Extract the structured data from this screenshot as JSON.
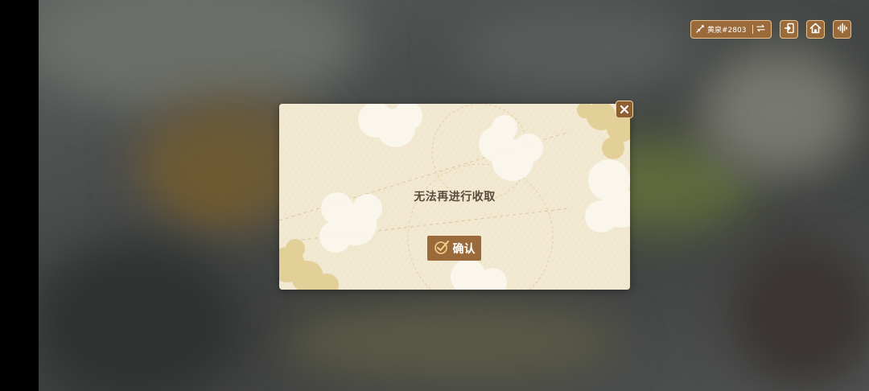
{
  "top_bar": {
    "server_label": "黄泉#2803",
    "server_icon": "sword-icon",
    "switch_icon": "swap-arrows-icon",
    "buttons": [
      {
        "name": "exit-button",
        "icon": "exit-door-icon"
      },
      {
        "name": "home-button",
        "icon": "home-icon"
      },
      {
        "name": "voice-button",
        "icon": "audio-wave-icon"
      }
    ]
  },
  "dialog": {
    "message": "无法再进行收取",
    "confirm_label": "确认",
    "confirm_icon": "checkmark-icon",
    "close_icon": "close-icon"
  },
  "colors": {
    "accent_brown": "#9a6a3a",
    "accent_border": "#e8c28a",
    "dialog_bg": "#f1e7cf",
    "text_dark": "#5a4a3b"
  }
}
